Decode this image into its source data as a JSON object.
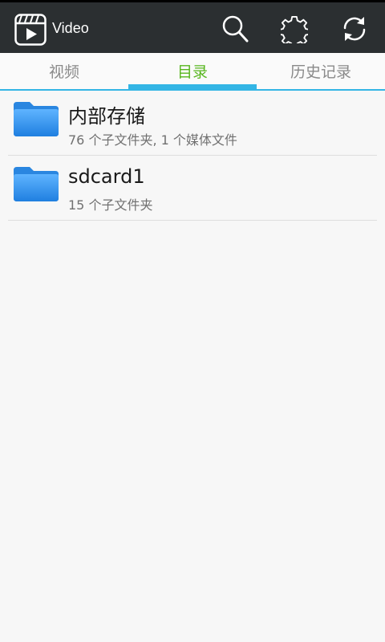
{
  "app": {
    "title": "Video"
  },
  "toolbar": {
    "icons": [
      "search-icon",
      "settings-gear-icon",
      "refresh-icon"
    ]
  },
  "tabs": [
    {
      "label": "视频",
      "active": false
    },
    {
      "label": "目录",
      "active": true
    },
    {
      "label": "历史记录",
      "active": false
    }
  ],
  "colors": {
    "appbar": "#2b2f31",
    "tab_active": "#58b61f",
    "tab_inactive": "#8a8a8a",
    "indicator": "#33b5e5",
    "folder": "#2e8fe8"
  },
  "folders": [
    {
      "name": "内部存储",
      "detail": "76 个子文件夹, 1 个媒体文件"
    },
    {
      "name": "sdcard1",
      "detail": "15 个子文件夹"
    }
  ]
}
